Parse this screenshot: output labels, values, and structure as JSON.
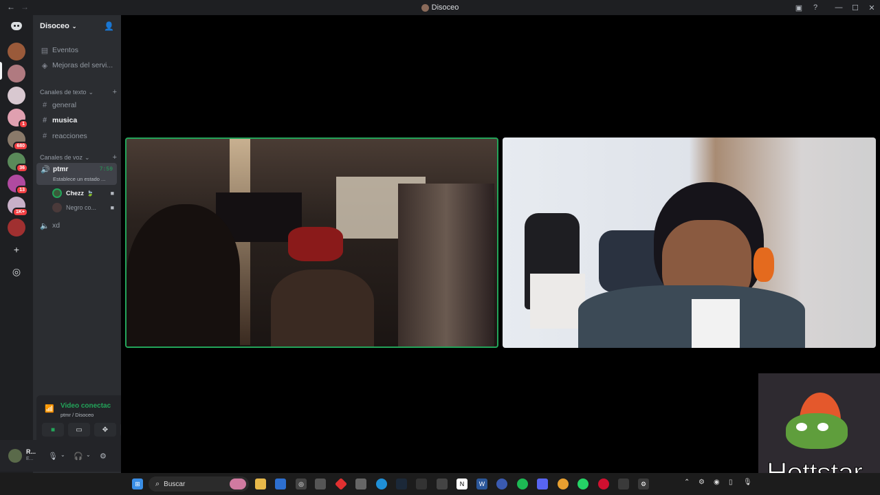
{
  "window": {
    "title": "Disoceo",
    "controls": [
      "inbox-icon",
      "help-icon",
      "minimize-icon",
      "maximize-icon",
      "close-icon"
    ]
  },
  "guild_badges": [
    "1",
    "680",
    "36",
    "13",
    "1K+"
  ],
  "server": {
    "name": "Disoceo"
  },
  "channels": {
    "events": "Eventos",
    "boost": "Mejoras del servi...",
    "text_category": "Canales de texto",
    "text": [
      "general",
      "musica",
      "reacciones"
    ],
    "voice_category": "Canales de voz",
    "active_voice": {
      "name": "ptmr",
      "time": "7:59",
      "status": "Establece un estado ..."
    },
    "voice_users": [
      "Chezz",
      "Negro co..."
    ],
    "other_voice": "xd"
  },
  "voice_panel": {
    "status": "Video conectac",
    "location": "ptmr / Disoceo"
  },
  "user": {
    "name": "R...",
    "sub": "E..."
  },
  "stream": {
    "overlay_text": "Hottstar"
  },
  "taskbar": {
    "search_placeholder": "Buscar"
  },
  "colors": {
    "accent_green": "#23a55a",
    "sidebar": "#2b2d31",
    "guild_bar": "#1e1f22",
    "mention_red": "#f23f43"
  }
}
